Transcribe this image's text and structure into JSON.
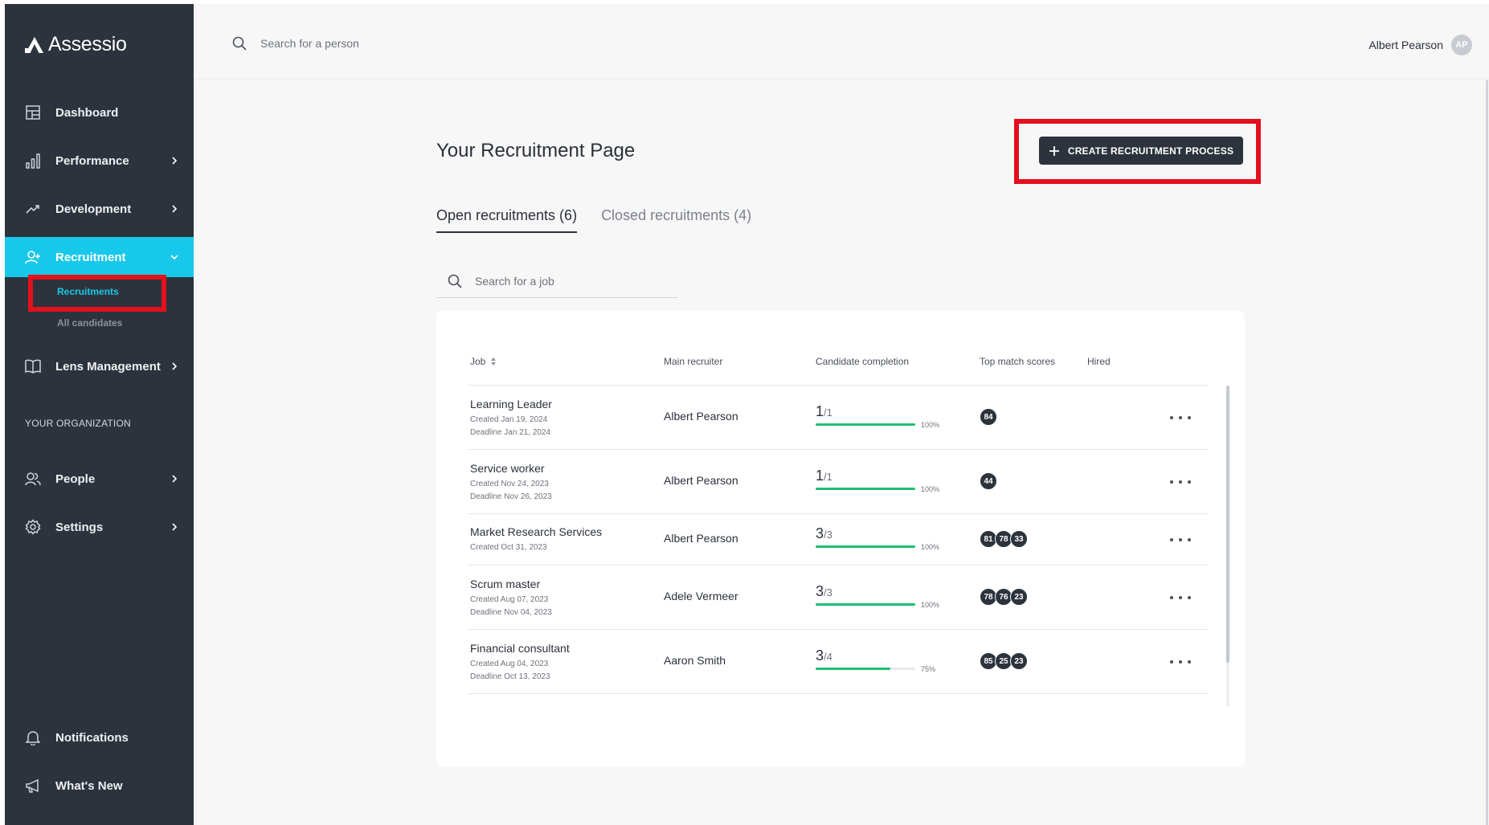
{
  "app": {
    "logo_text": "Assessio"
  },
  "topbar": {
    "search_placeholder": "Search for a person",
    "user_name": "Albert Pearson",
    "user_initials": "AP"
  },
  "sidebar": {
    "items": [
      {
        "label": "Dashboard",
        "icon": "dashboard-icon"
      },
      {
        "label": "Performance",
        "icon": "bar-chart-icon"
      },
      {
        "label": "Development",
        "icon": "trend-up-icon"
      },
      {
        "label": "Recruitment",
        "icon": "user-plus-icon"
      },
      {
        "label": "Lens Management",
        "icon": "book-icon"
      }
    ],
    "sub_items": [
      {
        "label": "Recruitments"
      },
      {
        "label": "All candidates"
      }
    ],
    "section_label": "YOUR ORGANIZATION",
    "org_items": [
      {
        "label": "People",
        "icon": "people-icon"
      },
      {
        "label": "Settings",
        "icon": "gear-icon"
      }
    ],
    "bottom_items": [
      {
        "label": "Notifications",
        "icon": "bell-icon"
      },
      {
        "label": "What's New",
        "icon": "megaphone-icon"
      }
    ]
  },
  "main": {
    "title": "Your Recruitment Page",
    "create_button": "CREATE RECRUITMENT PROCESS",
    "tabs": [
      {
        "label": "Open recruitments (6)"
      },
      {
        "label": "Closed recruitments (4)"
      }
    ],
    "job_search_placeholder": "Search for a job",
    "table": {
      "headers": {
        "job": "Job",
        "recruiter": "Main recruiter",
        "completion": "Candidate completion",
        "scores": "Top match scores",
        "hired": "Hired"
      },
      "rows": [
        {
          "title": "Learning Leader",
          "created": "Created Jan 19, 2024",
          "deadline": "Deadline Jan 21, 2024",
          "recruiter": "Albert Pearson",
          "done": "1",
          "total": "/1",
          "progress": 1.0,
          "pct": "100%",
          "scores": [
            "84"
          ]
        },
        {
          "title": "Service worker",
          "created": "Created Nov 24, 2023",
          "deadline": "Deadline Nov 26, 2023",
          "recruiter": "Albert Pearson",
          "done": "1",
          "total": "/1",
          "progress": 1.0,
          "pct": "100%",
          "scores": [
            "44"
          ]
        },
        {
          "title": "Market Research Services",
          "created": "Created Oct 31, 2023",
          "deadline": "",
          "recruiter": "Albert Pearson",
          "done": "3",
          "total": "/3",
          "progress": 1.0,
          "pct": "100%",
          "scores": [
            "81",
            "78",
            "33"
          ]
        },
        {
          "title": "Scrum master",
          "created": "Created Aug 07, 2023",
          "deadline": "Deadline Nov 04, 2023",
          "recruiter": "Adele Vermeer",
          "done": "3",
          "total": "/3",
          "progress": 1.0,
          "pct": "100%",
          "scores": [
            "78",
            "76",
            "23"
          ]
        },
        {
          "title": "Financial consultant",
          "created": "Created Aug 04, 2023",
          "deadline": "Deadline Oct 13, 2023",
          "recruiter": "Aaron Smith",
          "done": "3",
          "total": "/4",
          "progress": 0.75,
          "pct": "75%",
          "scores": [
            "85",
            "25",
            "23"
          ]
        }
      ]
    }
  },
  "colors": {
    "sidebar_bg": "#2d333c",
    "accent": "#17c8ea",
    "progress": "#1dbf73",
    "highlight_box": "#e3101d"
  }
}
